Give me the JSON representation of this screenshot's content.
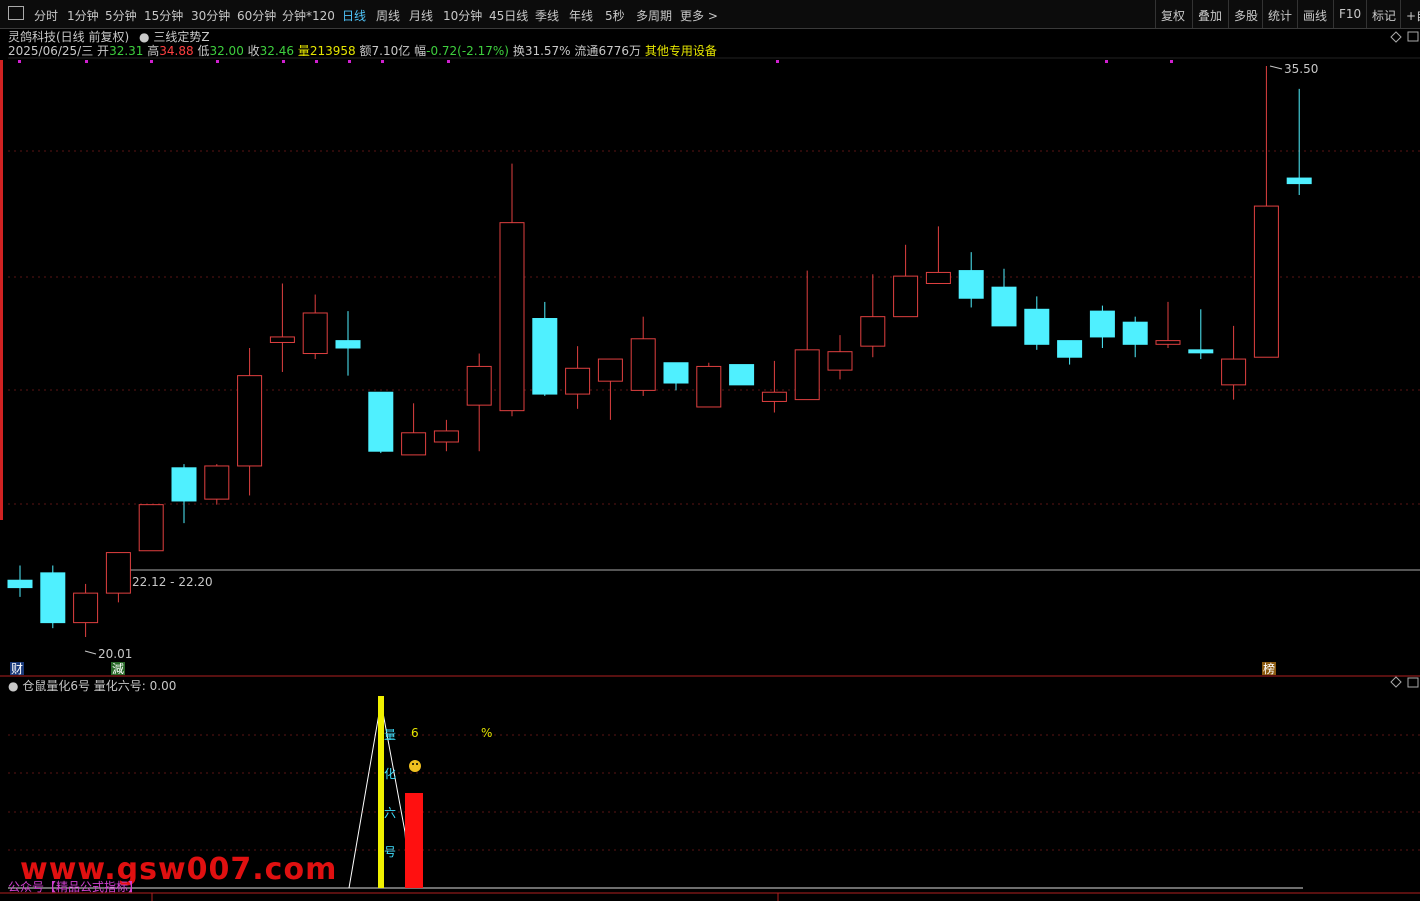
{
  "toolbar": {
    "periods": [
      "分时",
      "1分钟",
      "5分钟",
      "15分钟",
      "30分钟",
      "60分钟",
      "分钟*120",
      "日线",
      "周线",
      "月线",
      "10分钟",
      "45日线",
      "季线",
      "年线",
      "5秒",
      "多周期",
      "更多 >"
    ],
    "active": "日线",
    "right": [
      "复权",
      "叠加",
      "多股",
      "统计",
      "画线",
      "F10",
      "标记",
      "+自"
    ]
  },
  "header": {
    "stock": "灵鸽科技(日线 前复权)",
    "indicator": "三线定势Z",
    "date": "2025/06/25/三",
    "open_label": "开",
    "open": "32.31",
    "high_label": "高",
    "high": "34.88",
    "low_label": "低",
    "low": "32.00",
    "close_label": "收",
    "close": "32.46",
    "vol_label": "量",
    "vol": "213958",
    "amt_label": "额",
    "amt": "7.10亿",
    "chg_label": "幅",
    "chg": "-0.72(-2.17%)",
    "turn_label": "换",
    "turn": "31.57%",
    "float_label": "流通",
    "float": "6776万",
    "device": "其他专用设备"
  },
  "markers": {
    "max": "35.50",
    "min": "20.01",
    "range": "22.12 - 22.20",
    "cai": "财",
    "jian": "減",
    "bang": "榜"
  },
  "indicator_panel": {
    "name": "仓鼠量化6号",
    "value_label": "量化六号:",
    "value": "0.00",
    "vertical_text": [
      "量",
      "化",
      "六",
      "号"
    ],
    "six": "6",
    "pct": "%"
  },
  "footer": {
    "watermark": "www.gsw007.com",
    "pub": "公众号【精品公式指标】"
  },
  "colors": {
    "up": "#e04040",
    "down": "#4ff0ff",
    "bg": "#000000"
  },
  "chart_data": {
    "type": "candlestick",
    "price_max_label": 35.5,
    "price_min_label": 20.01,
    "candles": [
      {
        "o": 21.55,
        "c": 21.35,
        "h": 21.95,
        "l": 21.1
      },
      {
        "o": 21.75,
        "c": 20.4,
        "h": 21.95,
        "l": 20.25
      },
      {
        "o": 20.4,
        "c": 21.2,
        "h": 21.45,
        "l": 20.01
      },
      {
        "o": 21.2,
        "c": 22.3,
        "h": 22.3,
        "l": 20.95
      },
      {
        "o": 22.35,
        "c": 23.6,
        "h": 23.6,
        "l": 22.35
      },
      {
        "o": 24.6,
        "c": 23.7,
        "h": 24.7,
        "l": 23.1
      },
      {
        "o": 23.75,
        "c": 24.65,
        "h": 24.7,
        "l": 23.6
      },
      {
        "o": 24.65,
        "c": 27.1,
        "h": 27.85,
        "l": 23.85
      },
      {
        "o": 28.0,
        "c": 28.15,
        "h": 29.6,
        "l": 27.2
      },
      {
        "o": 27.7,
        "c": 28.8,
        "h": 29.3,
        "l": 27.55
      },
      {
        "o": 28.05,
        "c": 27.85,
        "h": 28.85,
        "l": 27.1
      },
      {
        "o": 26.65,
        "c": 25.05,
        "h": 26.65,
        "l": 25.0
      },
      {
        "o": 24.95,
        "c": 25.55,
        "h": 26.35,
        "l": 24.95
      },
      {
        "o": 25.3,
        "c": 25.6,
        "h": 25.9,
        "l": 25.05
      },
      {
        "o": 26.3,
        "c": 27.35,
        "h": 27.7,
        "l": 25.05
      },
      {
        "o": 26.15,
        "c": 31.25,
        "h": 32.85,
        "l": 26.0
      },
      {
        "o": 28.65,
        "c": 26.6,
        "h": 29.1,
        "l": 26.55
      },
      {
        "o": 26.6,
        "c": 27.3,
        "h": 27.9,
        "l": 26.2
      },
      {
        "o": 26.95,
        "c": 27.55,
        "h": 27.55,
        "l": 25.9
      },
      {
        "o": 26.7,
        "c": 28.1,
        "h": 28.7,
        "l": 26.55
      },
      {
        "o": 27.45,
        "c": 26.9,
        "h": 27.45,
        "l": 26.7
      },
      {
        "o": 26.25,
        "c": 27.35,
        "h": 27.45,
        "l": 26.25
      },
      {
        "o": 27.4,
        "c": 26.85,
        "h": 27.35,
        "l": 27.35
      },
      {
        "o": 26.4,
        "c": 26.65,
        "h": 27.5,
        "l": 26.1
      },
      {
        "o": 26.45,
        "c": 27.8,
        "h": 29.95,
        "l": 26.45
      },
      {
        "o": 27.25,
        "c": 27.75,
        "h": 28.2,
        "l": 27.0
      },
      {
        "o": 27.9,
        "c": 28.7,
        "h": 29.85,
        "l": 27.6
      },
      {
        "o": 28.7,
        "c": 29.8,
        "h": 30.65,
        "l": 28.7
      },
      {
        "o": 29.6,
        "c": 29.9,
        "h": 31.15,
        "l": 29.6
      },
      {
        "o": 29.95,
        "c": 29.2,
        "h": 30.45,
        "l": 28.95
      },
      {
        "o": 29.5,
        "c": 28.45,
        "h": 30.0,
        "l": 28.45
      },
      {
        "o": 28.9,
        "c": 27.95,
        "h": 29.25,
        "l": 27.8
      },
      {
        "o": 28.05,
        "c": 27.6,
        "h": 28.05,
        "l": 27.4
      },
      {
        "o": 28.85,
        "c": 28.15,
        "h": 29.0,
        "l": 27.85
      },
      {
        "o": 28.55,
        "c": 27.95,
        "h": 28.7,
        "l": 27.6
      },
      {
        "o": 27.95,
        "c": 28.05,
        "h": 29.1,
        "l": 27.85
      },
      {
        "o": 27.8,
        "c": 27.75,
        "h": 28.9,
        "l": 27.55
      },
      {
        "o": 26.85,
        "c": 27.55,
        "h": 28.45,
        "l": 26.45
      },
      {
        "o": 27.6,
        "c": 31.7,
        "h": 35.5,
        "l": 27.6
      },
      {
        "o": 32.46,
        "c": 32.31,
        "h": 34.88,
        "l": 32.0
      }
    ]
  }
}
